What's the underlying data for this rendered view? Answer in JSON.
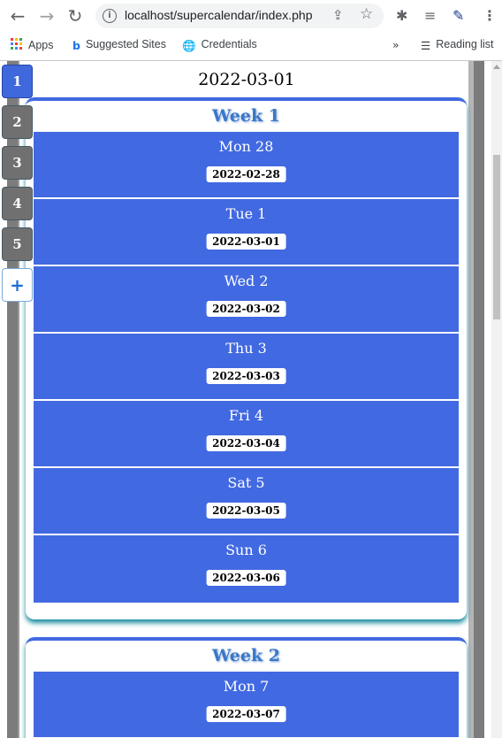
{
  "browser": {
    "url": "localhost/supercalendar/index.php",
    "bookmarks": [
      "Apps",
      "Suggested Sites",
      "Credentials"
    ],
    "reading_list": "Reading list"
  },
  "calendar": {
    "current_date": "2022-03-01",
    "tabs": [
      "1",
      "2",
      "3",
      "4",
      "5",
      "+"
    ],
    "active_tab": "1",
    "weeks": [
      {
        "title": "Week 1",
        "days": [
          {
            "name": "Mon 28",
            "date": "2022-02-28"
          },
          {
            "name": "Tue 1",
            "date": "2022-03-01"
          },
          {
            "name": "Wed 2",
            "date": "2022-03-02"
          },
          {
            "name": "Thu 3",
            "date": "2022-03-03"
          },
          {
            "name": "Fri 4",
            "date": "2022-03-04"
          },
          {
            "name": "Sat 5",
            "date": "2022-03-05"
          },
          {
            "name": "Sun 6",
            "date": "2022-03-06"
          }
        ]
      },
      {
        "title": "Week 2",
        "days": [
          {
            "name": "Mon 7",
            "date": "2022-03-07"
          }
        ]
      }
    ]
  },
  "colors": {
    "day_bg": "#4169e1",
    "tab_bg": "#707070",
    "tab_active": "#3f68dc"
  }
}
